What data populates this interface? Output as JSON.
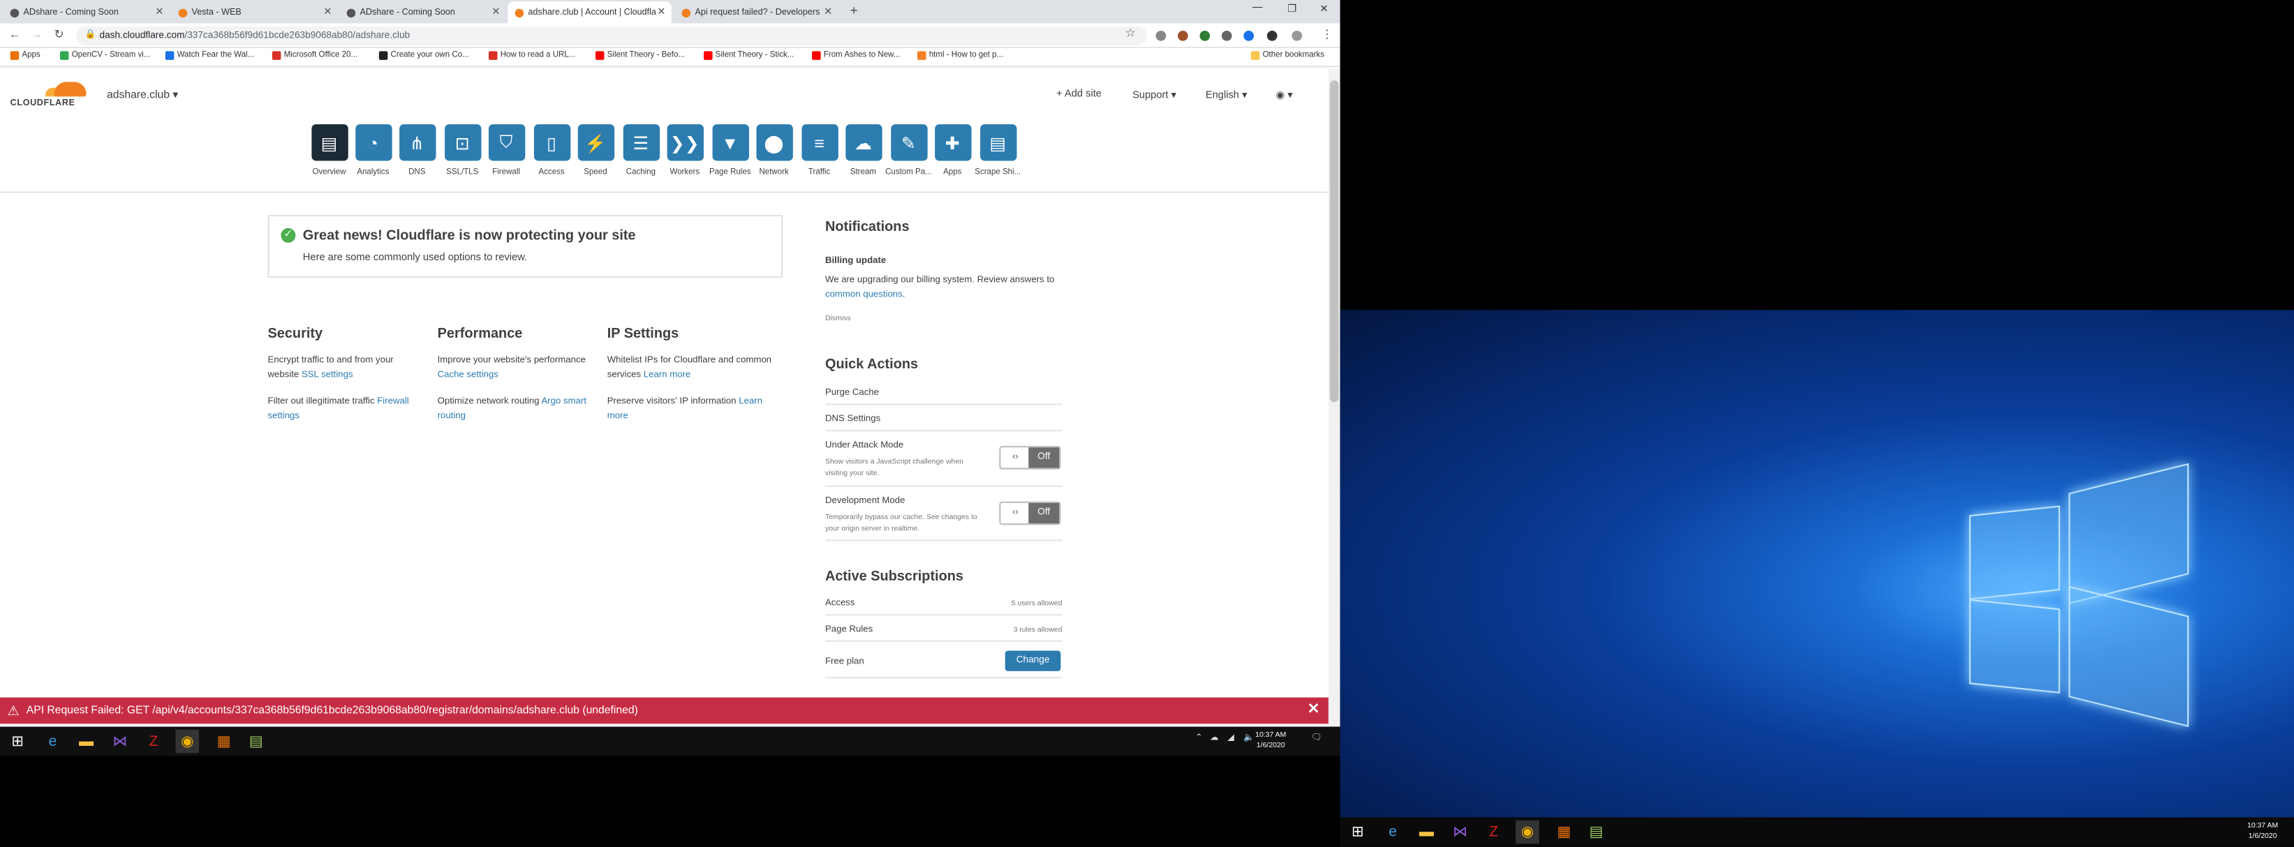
{
  "browser": {
    "tabs": [
      {
        "title": "ADshare - Coming Soon",
        "color": "#555555"
      },
      {
        "title": "Vesta - WEB",
        "color": "#f38020"
      },
      {
        "title": "ADshare - Coming Soon",
        "color": "#555555"
      },
      {
        "title": "adshare.club | Account | Cloudfla",
        "color": "#f38020"
      },
      {
        "title": "Api request failed? - Developers",
        "color": "#f38020"
      }
    ],
    "url_host": "dash.cloudflare.com",
    "url_path": "/337ca368b56f9d61bcde263b9068ab80/adshare.club",
    "bookmarks": [
      {
        "label": "Apps",
        "color": "#e8710a"
      },
      {
        "label": "OpenCV - Stream vi...",
        "color": "#34a853"
      },
      {
        "label": "Watch Fear the Wal...",
        "color": "#1a73e8"
      },
      {
        "label": "Microsoft Office 20...",
        "color": "#d93025"
      },
      {
        "label": "Create your own Co...",
        "color": "#222222"
      },
      {
        "label": "How to read a URL...",
        "color": "#d93025"
      },
      {
        "label": "Silent Theory - Befo...",
        "color": "#ff0000"
      },
      {
        "label": "Silent Theory - Stick...",
        "color": "#ff0000"
      },
      {
        "label": "From Ashes to New...",
        "color": "#ff0000"
      },
      {
        "label": "html - How to get p...",
        "color": "#f48024"
      }
    ],
    "other_bookmarks": "Other bookmarks"
  },
  "header": {
    "logo_text": "CLOUDFLARE",
    "site": "adshare.club",
    "add_site": "+ Add site",
    "support": "Support",
    "language": "English"
  },
  "nav": [
    {
      "label": "Overview",
      "icon": "clipboard-icon",
      "glyph": "▤"
    },
    {
      "label": "Analytics",
      "icon": "pie-chart-icon",
      "glyph": "◔"
    },
    {
      "label": "DNS",
      "icon": "network-icon",
      "glyph": "⋔"
    },
    {
      "label": "SSL/TLS",
      "icon": "lock-icon",
      "glyph": "⊡"
    },
    {
      "label": "Firewall",
      "icon": "shield-icon",
      "glyph": "⛉"
    },
    {
      "label": "Access",
      "icon": "book-icon",
      "glyph": "▯"
    },
    {
      "label": "Speed",
      "icon": "lightning-icon",
      "glyph": "⚡"
    },
    {
      "label": "Caching",
      "icon": "server-icon",
      "glyph": "☰"
    },
    {
      "label": "Workers",
      "icon": "workers-icon",
      "glyph": "❯❯"
    },
    {
      "label": "Page Rules",
      "icon": "filter-icon",
      "glyph": "▼"
    },
    {
      "label": "Network",
      "icon": "location-pin-icon",
      "glyph": "⬤"
    },
    {
      "label": "Traffic",
      "icon": "list-icon",
      "glyph": "≡"
    },
    {
      "label": "Stream",
      "icon": "cloud-upload-icon",
      "glyph": "☁"
    },
    {
      "label": "Custom Pa...",
      "icon": "wrench-icon",
      "glyph": "✎"
    },
    {
      "label": "Apps",
      "icon": "plus-icon",
      "glyph": "✚"
    },
    {
      "label": "Scrape Shi...",
      "icon": "document-icon",
      "glyph": "▤"
    }
  ],
  "banner": {
    "title": "Great news! Cloudflare is now protecting your site",
    "subtitle": "Here are some commonly used options to review."
  },
  "columns": {
    "security": {
      "title": "Security",
      "p1_text": "Encrypt traffic to and from your website ",
      "p1_link": "SSL settings",
      "p2_text": "Filter out illegitimate traffic ",
      "p2_link": "Firewall settings"
    },
    "performance": {
      "title": "Performance",
      "p1_text": "Improve your website's performance ",
      "p1_link": "Cache settings",
      "p2_text": "Optimize network routing ",
      "p2_link": "Argo smart routing"
    },
    "ip": {
      "title": "IP Settings",
      "p1_text": "Whitelist IPs for Cloudflare and common services ",
      "p1_link": "Learn more",
      "p2_text": "Preserve visitors' IP information ",
      "p2_link": "Learn more"
    }
  },
  "notifications": {
    "title": "Notifications",
    "item_title": "Billing update",
    "item_text": "We are upgrading our billing system. Review answers to ",
    "item_link": "common questions",
    "item_end": ".",
    "dismiss": "Dismiss"
  },
  "quick_actions": {
    "title": "Quick Actions",
    "purge_cache": "Purge Cache",
    "dns_settings": "DNS Settings",
    "uam_title": "Under Attack Mode",
    "uam_desc": "Show visitors a JavaScript challenge when visiting your site.",
    "uam_state": "Off",
    "dev_title": "Development Mode",
    "dev_desc": "Temporarily bypass our cache. See changes to your origin server in realtime.",
    "dev_state": "Off",
    "toggle_glyph": "‹›"
  },
  "subscriptions": {
    "title": "Active Subscriptions",
    "rows": [
      {
        "name": "Access",
        "value": "5 users allowed"
      },
      {
        "name": "Page Rules",
        "value": "3 rules allowed"
      }
    ],
    "plan": "Free plan",
    "change": "Change"
  },
  "error_bar": {
    "text": "API Request Failed: GET /api/v4/accounts/337ca368b56f9d61bcde263b9068ab80/registrar/domains/adshare.club (undefined)"
  },
  "taskbar": {
    "time": "10:37 AM",
    "date": "1/6/2020"
  }
}
